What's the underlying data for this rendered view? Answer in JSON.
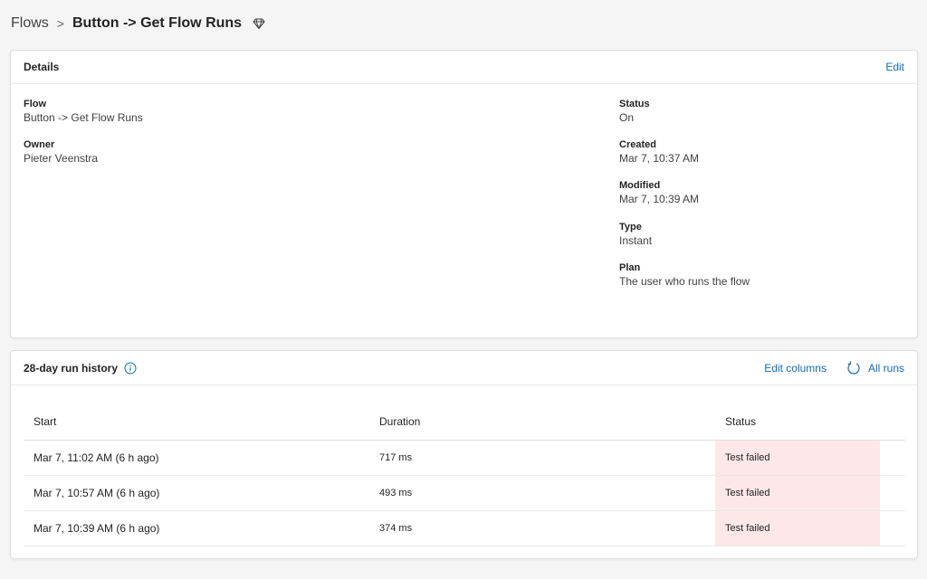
{
  "breadcrumb": {
    "root": "Flows",
    "separator": ">",
    "current": "Button -> Get Flow Runs",
    "icon": "premium-diamond-icon"
  },
  "details": {
    "title": "Details",
    "edit_label": "Edit",
    "flow": {
      "label": "Flow",
      "value": "Button -> Get Flow Runs"
    },
    "owner": {
      "label": "Owner",
      "value": "Pieter Veenstra"
    },
    "status": {
      "label": "Status",
      "value": "On"
    },
    "created": {
      "label": "Created",
      "value": "Mar 7, 10:37 AM"
    },
    "modified": {
      "label": "Modified",
      "value": "Mar 7, 10:39 AM"
    },
    "type": {
      "label": "Type",
      "value": "Instant"
    },
    "plan": {
      "label": "Plan",
      "value": "The user who runs the flow"
    }
  },
  "history": {
    "title": "28-day run history",
    "info_icon": "info-icon",
    "edit_columns_label": "Edit columns",
    "all_runs_label": "All runs",
    "all_runs_icon": "refresh-icon",
    "columns": [
      "Start",
      "Duration",
      "Status"
    ],
    "rows": [
      {
        "start": "Mar 7, 11:02 AM (6 h ago)",
        "duration": "717 ms",
        "status": "Test failed"
      },
      {
        "start": "Mar 7, 10:57 AM (6 h ago)",
        "duration": "493 ms",
        "status": "Test failed"
      },
      {
        "start": "Mar 7, 10:39 AM (6 h ago)",
        "duration": "374 ms",
        "status": "Test failed"
      }
    ]
  },
  "colors": {
    "accent": "#0f6cbd",
    "failed_bg": "#fde7e9"
  }
}
